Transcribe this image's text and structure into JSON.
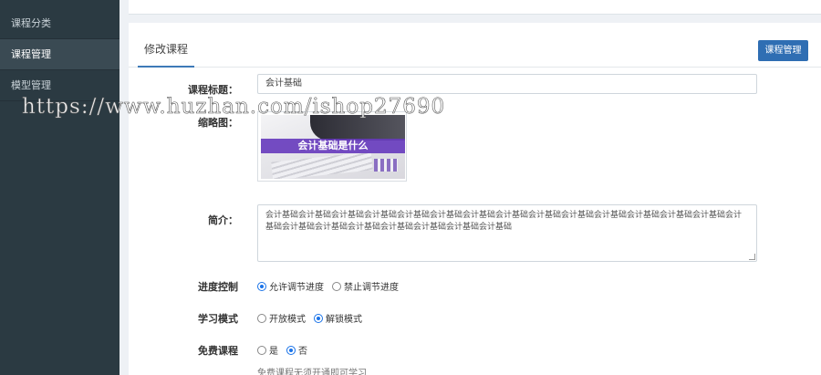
{
  "sidebar": {
    "items": [
      {
        "label": "课程分类",
        "active": false
      },
      {
        "label": "课程管理",
        "active": true
      },
      {
        "label": "模型管理",
        "active": false
      }
    ]
  },
  "main": {
    "tab_label": "修改课程",
    "manage_button": "课程管理",
    "form": {
      "title_label": "课程标题：",
      "title_value": "会计基础",
      "thumb_label": "缩略图：",
      "thumb_caption": "会计基础是什么",
      "intro_label": "简介：",
      "intro_value": "会计基础会计基础会计基础会计基础会计基础会计基础会计基础会计基础会计基础会计基础会计基础会计基础会计基础会计基础会计基础会计基础会计基础会计基础会计基础会计基础会计基础会计基础",
      "progress_label": "进度控制",
      "progress_options": [
        "允许调节进度",
        "禁止调节进度"
      ],
      "progress_selected": "允许调节进度",
      "study_label": "学习模式",
      "study_options": [
        "开放模式",
        "解锁模式"
      ],
      "study_selected": "解锁模式",
      "free_label": "免费课程",
      "free_options": [
        "是",
        "否"
      ],
      "free_selected": "否",
      "free_hint": "免费课程无须开通即可学习"
    }
  },
  "watermark": "https://www.huzhan.com/ishop27690",
  "colors": {
    "sidebar_bg": "#2b3a42",
    "accent": "#2f6eb3",
    "radio_selected": "#1a73e8"
  }
}
